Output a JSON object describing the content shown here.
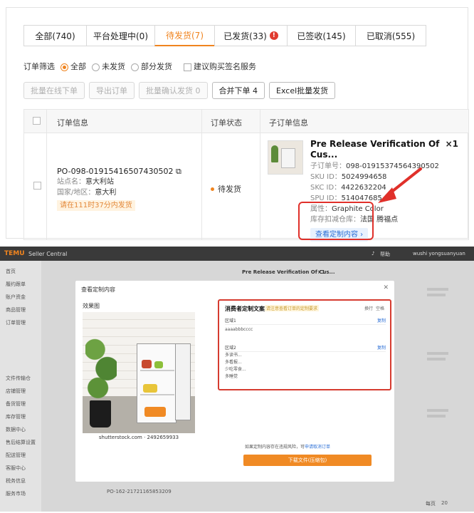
{
  "top": {
    "tabs": [
      {
        "label": "全部(740)",
        "w": 88
      },
      {
        "label": "平台处理中(0)",
        "w": 96
      },
      {
        "label": "待发货(7)",
        "w": 84,
        "active": true
      },
      {
        "label": "已发货(33)",
        "w": 102,
        "badge": "!"
      },
      {
        "label": "已签收(145)",
        "w": 96
      },
      {
        "label": "已取消(555)",
        "w": 100
      }
    ],
    "filter": {
      "label": "订单筛选",
      "options": [
        "全部",
        "未发货",
        "部分发货"
      ],
      "selected": "全部",
      "checkbox_label": "建议购买签名服务"
    },
    "buttons": [
      "批量在线下单",
      "导出订单",
      "批量确认发货 0",
      "合并下单 4",
      "Excel批量发货"
    ],
    "table_headers": [
      "订单信息",
      "订单状态",
      "子订单信息"
    ],
    "order": {
      "po": "PO-098-01915416507430502",
      "site_label": "站点名：",
      "site": "意大利站",
      "region_label": "国家/地区：",
      "region": "意大利",
      "deadline": "请在111时37分内发货",
      "status": "待发货"
    },
    "sub_order": {
      "title": "Pre Release Verification Of Cus...",
      "qty": "×1",
      "sub_no_label": "子订单号：",
      "sub_no": "098-01915374564390502",
      "sku_label": "SKU ID：",
      "sku": "5024994658",
      "skc_label": "SKC ID：",
      "skc": "4422632204",
      "spu_label": "SPU ID：",
      "spu": "514047685",
      "attr_label": "属性：",
      "attr": "Graphite Color",
      "warehouse_label": "库存扣减仓库：",
      "warehouse": "法国 腾福点",
      "view_label": "查看定制内容 ›"
    },
    "colors": {
      "accent": "#f0841f",
      "highlight": "#e0302a",
      "link": "#2b6fd6"
    }
  },
  "bottom": {
    "topbar": {
      "logo": "TEMU",
      "app": "Seller Central",
      "help": "帮助",
      "account": "wushi yongsuanyuan"
    },
    "sidebar": [
      "首页",
      "履约跟单",
      "账户资金",
      "商品管理",
      "订单管理",
      "",
      "",
      "",
      "",
      "文件传输仓",
      "店铺管理",
      "备货管理",
      "库存管理",
      "数据中心",
      "售后结算设置",
      "配送管理",
      "客服中心",
      "税务信息",
      "服务市场"
    ],
    "background_title": "Pre Release Verification Of Cus...",
    "background_qty": "×1",
    "background_order": "PO-162-21721165853209",
    "background_footer": {
      "page_label": "每页",
      "page_size": "20"
    },
    "modal": {
      "title": "查看定制内容",
      "preview_label": "效果图",
      "image_credit": "shutterstock.com · 2492659933",
      "custom_title": "消费者定制文案",
      "custom_tip": "请注意查看订单的定制要求",
      "option_wrap": "换行",
      "option_space": "空格",
      "area1": {
        "label": "区域1",
        "copy": "复制",
        "value": "aaaabbbcccc"
      },
      "area2": {
        "label": "区域2",
        "copy": "复制",
        "lines": [
          "多读书...",
          "多看报...",
          "少吃零食...",
          "多睡觉"
        ]
      },
      "download_tip": "如果定制内容存在违规风险，可",
      "download_tip_link": "申请取消订单",
      "download_button": "下载文件(压缩包)"
    }
  }
}
